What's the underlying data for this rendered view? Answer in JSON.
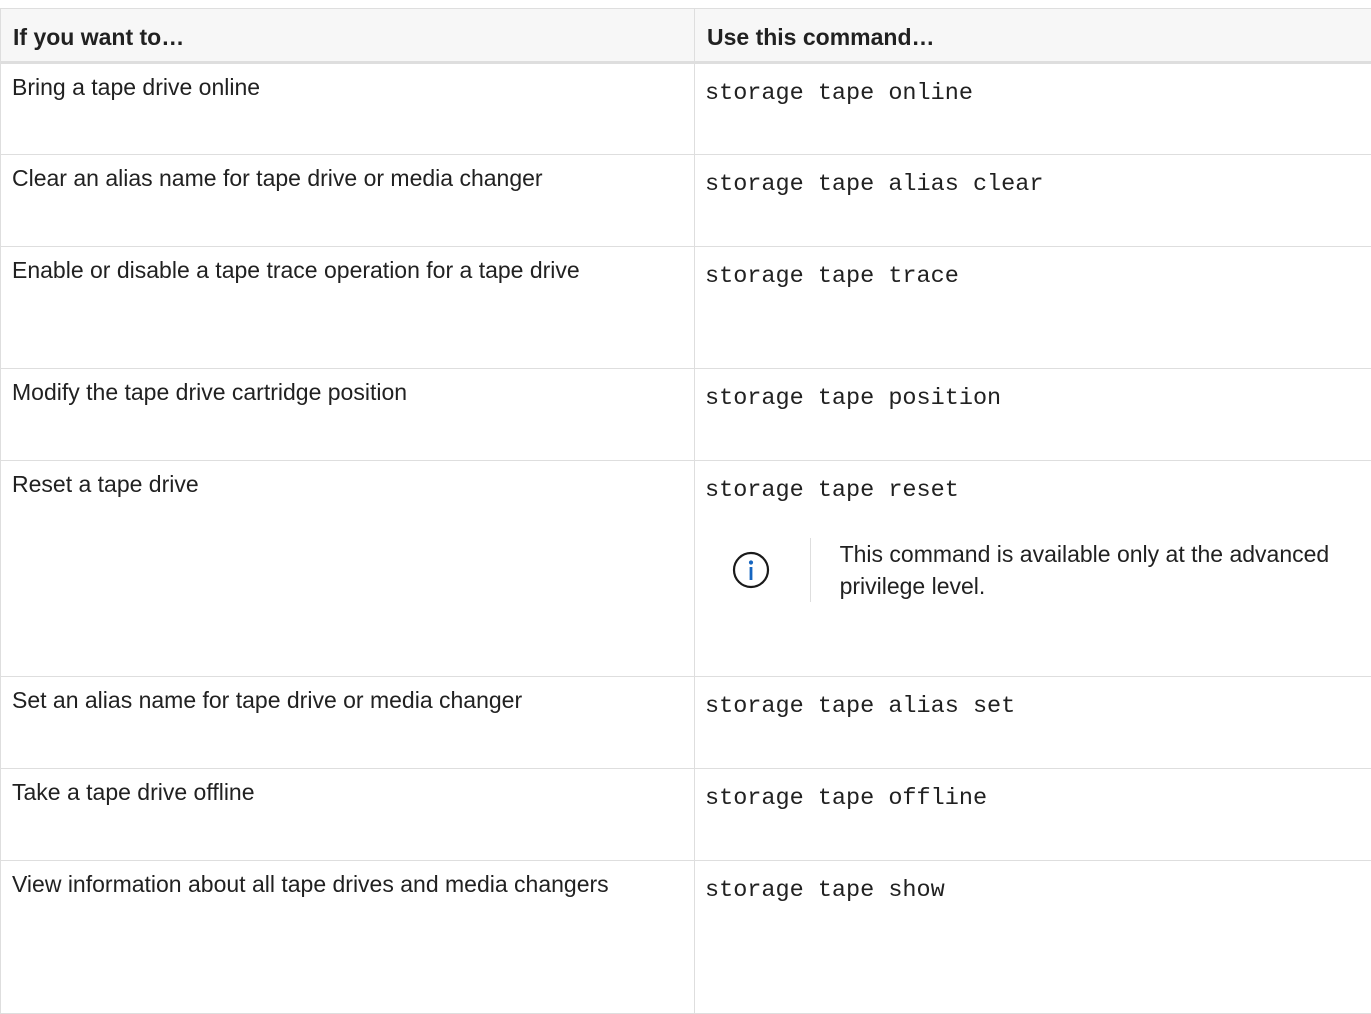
{
  "table": {
    "headers": [
      "If you want to…",
      "Use this command…"
    ],
    "rows": [
      {
        "task": "Bring a tape drive online",
        "command": "storage tape online"
      },
      {
        "task": "Clear an alias name for tape drive or media changer",
        "command": "storage tape alias clear"
      },
      {
        "task": "Enable or disable a tape trace operation for a tape drive",
        "command": "storage tape trace"
      },
      {
        "task": "Modify the tape drive cartridge position",
        "command": "storage tape position"
      },
      {
        "task": "Reset a tape drive",
        "command": "storage tape reset",
        "note": "This command is available only at the advanced privilege level.",
        "note_icon": "info-circle-icon"
      },
      {
        "task": "Set an alias name for tape drive or media changer",
        "command": "storage tape alias set"
      },
      {
        "task": "Take a tape drive offline",
        "command": "storage tape offline"
      },
      {
        "task": "View information about all tape drives and media changers",
        "command": "storage tape show"
      }
    ]
  },
  "colors": {
    "border": "#dedede",
    "header_bg": "#f7f7f7",
    "text": "#212121",
    "info_icon": "#1565c0"
  }
}
